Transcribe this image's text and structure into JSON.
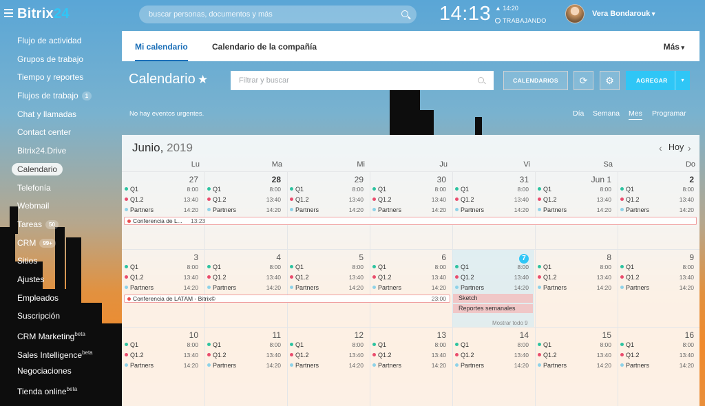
{
  "topbar": {
    "logo_text": "Bitrix",
    "logo_num": "24",
    "search_placeholder": "buscar personas, documentos y más",
    "clock": "14:13",
    "worktime_time": "▲ 14:20",
    "worktime_status": "TRABAJANDO",
    "user_name": "Vera Bondarouk"
  },
  "sidebar": {
    "items": [
      {
        "label": "Flujo de actividad"
      },
      {
        "label": "Grupos de trabajo"
      },
      {
        "label": "Tiempo y reportes"
      },
      {
        "label": "Flujos de trabajo",
        "badge": "1"
      },
      {
        "label": "Chat y llamadas"
      },
      {
        "label": "Contact center"
      },
      {
        "label": "Bitrix24.Drive"
      },
      {
        "label": "Calendario",
        "active": true
      },
      {
        "label": "Telefonía"
      },
      {
        "label": "Webmail"
      },
      {
        "label": "Tareas",
        "badge": "50"
      },
      {
        "label": "CRM",
        "badge": "99+"
      },
      {
        "label": "Sitios"
      },
      {
        "label": "Ajustes"
      },
      {
        "label": "Empleados"
      },
      {
        "label": "Suscripción"
      },
      {
        "label": "CRM Marketing",
        "sup": "beta"
      },
      {
        "label": "Sales Intelligence",
        "sup": "beta"
      },
      {
        "label": "Negociaciones"
      },
      {
        "label": "Tienda online",
        "sup": "beta"
      }
    ]
  },
  "tabs": {
    "my_calendar": "Mi calendario",
    "company_calendar": "Calendario de la compañía",
    "more": "Más"
  },
  "toolbar": {
    "title": "Calendario",
    "star": "★",
    "filter_placeholder": "Filtrar y buscar",
    "calendars_button": "CALENDARIOS",
    "sync_icon": "⟳",
    "settings_icon": "⚙",
    "add_button": "AGREGAR",
    "add_drop": "▾"
  },
  "subbar": {
    "no_events": "No hay eventos urgentes.",
    "view_day": "Día",
    "view_week": "Semana",
    "view_month": "Mes",
    "view_schedule": "Programar"
  },
  "calendar": {
    "month": "Junio,",
    "year": "2019",
    "today_button": "Hoy",
    "prev": "‹",
    "next": "›",
    "weekdays": [
      "Lu",
      "Ma",
      "Mi",
      "Ju",
      "Vi",
      "Sa",
      "Do"
    ],
    "weeks": [
      {
        "days": [
          "27",
          "28",
          "29",
          "30",
          "31",
          "Jun 1",
          "2"
        ]
      },
      {
        "days": [
          "3",
          "4",
          "5",
          "6",
          "7",
          "8",
          "9"
        ]
      },
      {
        "days": [
          "10",
          "11",
          "12",
          "13",
          "14",
          "15",
          "16"
        ]
      }
    ],
    "events": [
      {
        "name": "Q1",
        "time": "8:00",
        "color": "#2dc3a0"
      },
      {
        "name": "Q1.2",
        "time": "13:40",
        "color": "#ea4c6d"
      },
      {
        "name": "Partners",
        "time": "14:20",
        "color": "#8ed2e8"
      }
    ],
    "conference_week1": {
      "title": "Conferencia de L...",
      "time": "13:23"
    },
    "conference_week2": {
      "title": "Conferencia de LATAM - Bitrix©",
      "time": "23:00"
    },
    "sketch": "Sketch",
    "weekly_reports": "Reportes semanales",
    "show_all": "Mostrar todo 9"
  }
}
